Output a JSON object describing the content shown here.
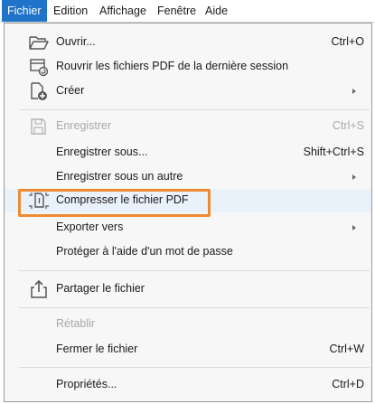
{
  "menubar": {
    "items": [
      "Fichier",
      "Edition",
      "Affichage",
      "Fenêtre",
      "Aide"
    ]
  },
  "menu": {
    "items": [
      {
        "label": "Ouvrir...",
        "shortcut": "Ctrl+O",
        "icon": "folder-open-icon"
      },
      {
        "label": "Rouvrir les fichiers PDF de la dernière session",
        "icon": "reopen-files-icon"
      },
      {
        "label": "Créer",
        "icon": "create-file-icon",
        "submenu": true
      },
      {
        "label": "Enregistrer",
        "shortcut": "Ctrl+S",
        "icon": "save-icon",
        "disabled": true
      },
      {
        "label": "Enregistrer sous...",
        "shortcut": "Shift+Ctrl+S"
      },
      {
        "label": "Enregistrer sous un autre",
        "submenu": true
      },
      {
        "label": "Compresser le fichier PDF",
        "icon": "compress-pdf-icon",
        "highlighted": true
      },
      {
        "label": "Exporter vers",
        "submenu": true
      },
      {
        "label": "Protéger à l'aide d'un mot de passe"
      },
      {
        "label": "Partager le fichier",
        "icon": "share-icon"
      },
      {
        "label": "Rétablir",
        "disabled": true
      },
      {
        "label": "Fermer le fichier",
        "shortcut": "Ctrl+W"
      },
      {
        "label": "Propriétés...",
        "shortcut": "Ctrl+D"
      }
    ]
  },
  "colors": {
    "active_menu": "#1f73c8",
    "highlight_border": "#ef8a32",
    "disabled_text": "#a8a8a8"
  }
}
